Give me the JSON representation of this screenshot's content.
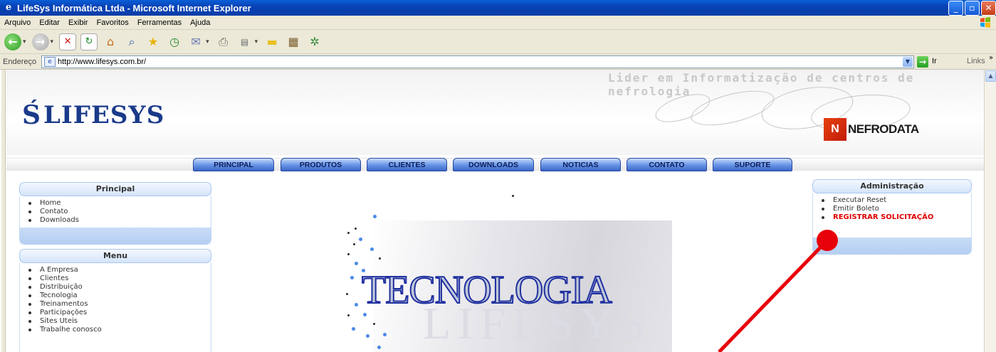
{
  "window": {
    "title": "LifeSys Informática Ltda - Microsoft Internet Explorer",
    "minimize": "_",
    "maximize": "▫",
    "close": "✕"
  },
  "menubar": {
    "items": [
      "Arquivo",
      "Editar",
      "Exibir",
      "Favoritos",
      "Ferramentas",
      "Ajuda"
    ]
  },
  "addressbar": {
    "label": "Endereço",
    "url": "http://www.lifesys.com.br/",
    "go_label": "Ir",
    "links_label": "Links"
  },
  "site": {
    "logo_text": "LIFESYS",
    "tagline": "Lider em Informatização de centros de nefrologia",
    "partner_name": "NEFRODATA",
    "nav": [
      "PRINCIPAL",
      "PRODUTOS",
      "CLIENTES",
      "DOWNLOADS",
      "NOTICIAS",
      "CONTATO",
      "SUPORTE"
    ],
    "principal": {
      "title": "Principal",
      "items": [
        "Home",
        "Contato",
        "Downloads"
      ]
    },
    "menu": {
      "title": "Menu",
      "items": [
        "A Empresa",
        "Clientes",
        "Distribuição",
        "Tecnologia",
        "Treinamentos",
        "Participações",
        "Sites Uteis",
        "Trabalhe conosco"
      ]
    },
    "admin": {
      "title": "Administração",
      "items": [
        "Executar Reset",
        "Emitir Boleto"
      ],
      "highlight": "REGISTRAR SOLICITAÇÃO"
    },
    "banner_text": "TECNOLOGIA",
    "banner_ghost": "LIFESYS"
  },
  "colors": {
    "annotation": "#e8000a",
    "nav_tab": "#6c98e8",
    "highlight_link": "#e00000"
  }
}
